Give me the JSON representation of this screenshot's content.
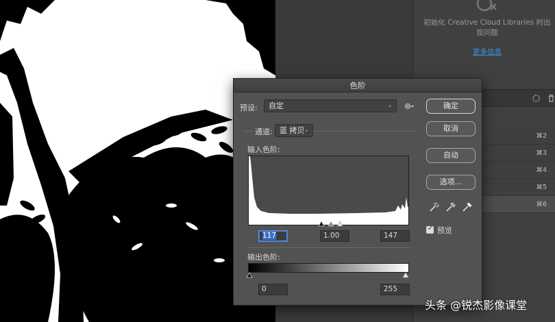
{
  "library_panel": {
    "message": "初始化 Creative Cloud Libraries 时出现问题",
    "link": "更多信息"
  },
  "shortcuts": [
    "⌘2",
    "⌘3",
    "⌘4",
    "⌘5",
    "⌘6"
  ],
  "dialog": {
    "title": "色阶",
    "preset_label": "预设:",
    "preset_value": "自定",
    "channel_label": "通道:",
    "channel_value": "蓝 拷贝",
    "input_levels_label": "输入色阶:",
    "input_black": "117",
    "input_gamma": "1.00",
    "input_white": "147",
    "output_levels_label": "输出色阶:",
    "output_black": "0",
    "output_white": "255",
    "buttons": {
      "ok": "确定",
      "cancel": "取消",
      "auto": "自动",
      "options": "选项..."
    },
    "preview_label": "预览",
    "preview_checked": true
  },
  "watermark": "头条 @锐杰影像课堂",
  "colors": {
    "link": "#3d8ee8",
    "focus": "#4b87e0",
    "dialog_bg": "#525252"
  }
}
